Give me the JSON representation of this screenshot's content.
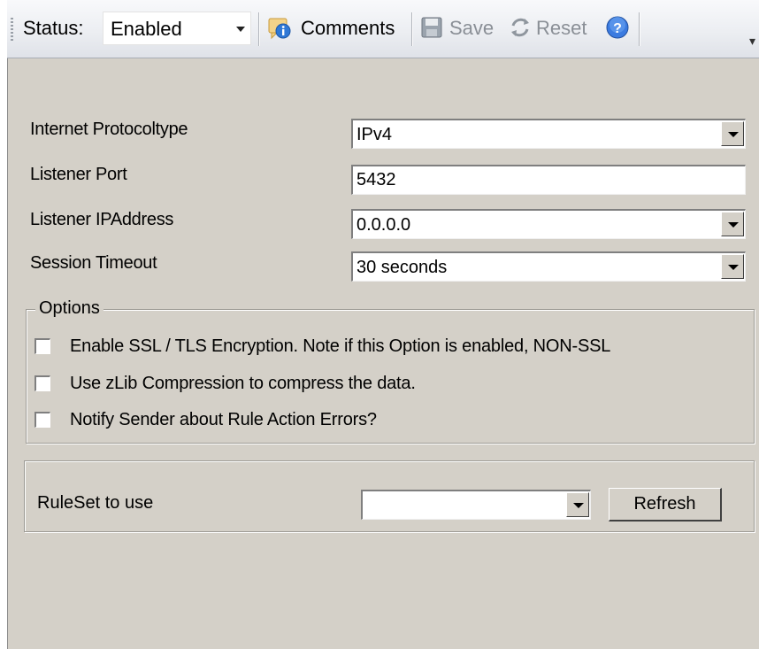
{
  "toolbar": {
    "status_label": "Status:",
    "status_value": "Enabled",
    "comments_label": "Comments",
    "save_label": "Save",
    "reset_label": "Reset",
    "icons": [
      "comments-icon",
      "save-icon",
      "reset-icon",
      "help-icon"
    ]
  },
  "form": {
    "fields": [
      {
        "label": "Internet Protocoltype",
        "value": "IPv4",
        "kind": "dropdown"
      },
      {
        "label": "Listener Port",
        "value": "5432",
        "kind": "text"
      },
      {
        "label": "Listener IPAddress",
        "value": "0.0.0.0",
        "kind": "dropdown"
      },
      {
        "label": "Session Timeout",
        "value": "30 seconds",
        "kind": "dropdown"
      }
    ]
  },
  "options": {
    "title": "Options",
    "items": [
      {
        "label": "Enable SSL / TLS Encryption. Note if this Option is enabled, NON-SSL",
        "checked": false
      },
      {
        "label": "Use zLib Compression to compress the data.",
        "checked": false
      },
      {
        "label": "Notify Sender about Rule Action Errors?",
        "checked": false
      }
    ]
  },
  "ruleset": {
    "label": "RuleSet to use",
    "value": "",
    "refresh_label": "Refresh"
  }
}
